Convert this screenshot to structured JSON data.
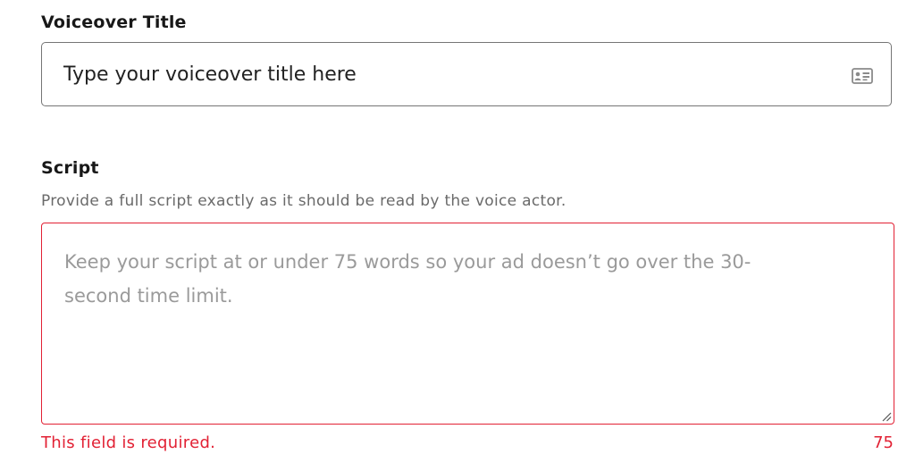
{
  "voiceover_title": {
    "label": "Voiceover Title",
    "placeholder": "Type your voiceover title here",
    "value": "",
    "icon": "contact-card-icon"
  },
  "script": {
    "label": "Script",
    "help_text": "Provide a full script exactly as it should be read by the voice actor.",
    "placeholder": "Keep your script at or under 75 words so your ad doesn’t go over the 30-second time limit.",
    "value": "",
    "error": "This field is required.",
    "counter": "75"
  },
  "colors": {
    "error": "#e22134",
    "border": "#757575",
    "help": "#6a6a6a",
    "placeholder": "#9a9a9a"
  }
}
